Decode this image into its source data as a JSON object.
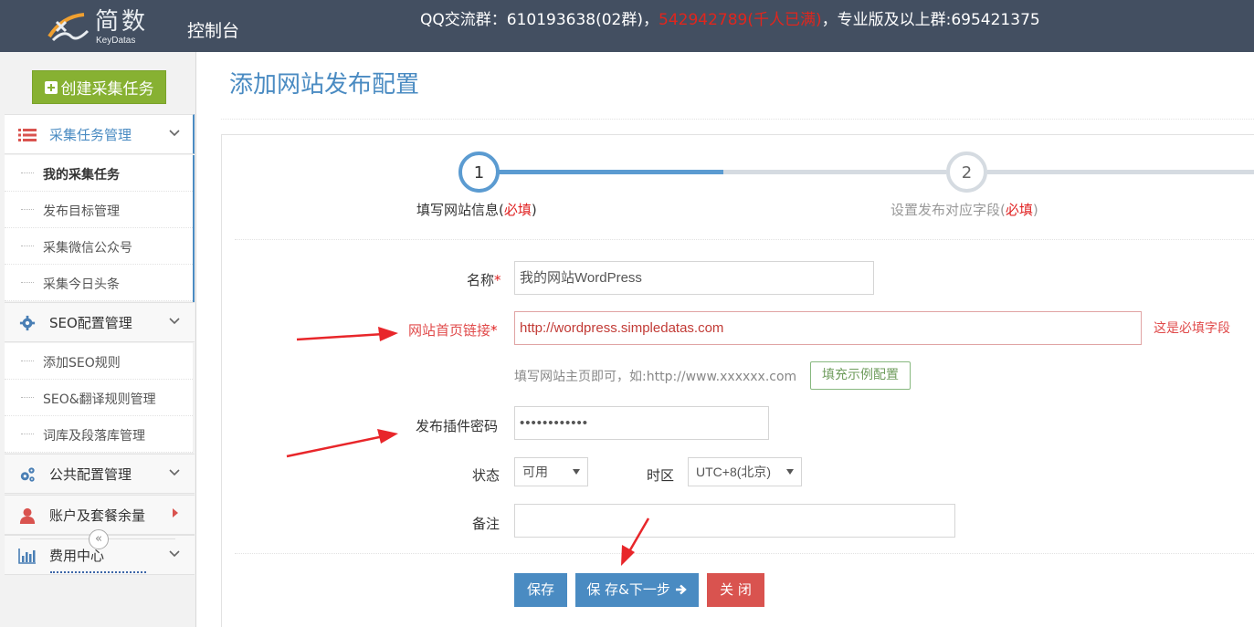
{
  "header": {
    "logo_name": "简数",
    "logo_sub": "KeyDatas",
    "console": "控制台",
    "qq_prefix": "QQ交流群：610193638(02群)，",
    "qq_full": "542942789(千人已满)",
    "qq_suffix": "，专业版及以上群:695421375"
  },
  "sidebar": {
    "create_button": "创建采集任务",
    "groups": [
      {
        "label": "采集任务管理",
        "icon": "list-icon",
        "items": [
          "我的采集任务",
          "发布目标管理",
          "采集微信公众号",
          "采集今日头条"
        ]
      },
      {
        "label": "SEO配置管理",
        "icon": "gear-icon",
        "items": [
          "添加SEO规则",
          "SEO&翻译规则管理",
          "词库及段落库管理"
        ]
      },
      {
        "label": "公共配置管理",
        "icon": "gears-icon",
        "items": []
      },
      {
        "label": "账户及套餐余量",
        "icon": "user-icon",
        "items": []
      },
      {
        "label": "费用中心",
        "icon": "bar-chart-icon",
        "items": []
      }
    ],
    "collapse_glyph": "«"
  },
  "page": {
    "title": "添加网站发布配置",
    "steps": [
      {
        "number": "1",
        "label": "填写网站信息(",
        "required": "必填",
        "close": ")"
      },
      {
        "number": "2",
        "label": "设置发布对应字段(",
        "required": "必填",
        "close": ")"
      }
    ]
  },
  "form": {
    "name_label": "名称",
    "name_value": "我的网站WordPress",
    "url_label": "网站首页链接",
    "url_value": "http://wordpress.simpledatas.com",
    "url_error": "这是必填字段",
    "url_help": "填写网站主页即可，如:http://www.xxxxxx.com",
    "fill_example": "填充示例配置",
    "password_label": "发布插件密码",
    "password_value": "••••••••••••",
    "status_label": "状态",
    "status_value": "可用",
    "timezone_label": "时区",
    "timezone_value": "UTC+8(北京)",
    "remark_label": "备注",
    "remark_value": "",
    "required_mark": "*"
  },
  "buttons": {
    "save": "保存",
    "save_next": "保 存&下一步",
    "close": "关 闭"
  },
  "colors": {
    "header_bg": "#434f61",
    "accent": "#4a8bc2",
    "green": "#87b132",
    "danger": "#d9534f",
    "annotation": "#e8262a"
  }
}
